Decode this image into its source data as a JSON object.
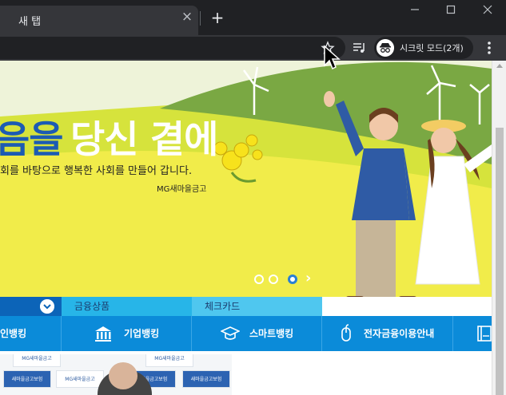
{
  "browser": {
    "tab_title": "새 탭",
    "profile_label": "시크릿 모드(2개)"
  },
  "banner": {
    "title_part1": "음을",
    "title_part2": "당신 곁에",
    "subtitle": "회를 바탕으로 행복한 사회를 만들어 갑니다.",
    "brand": "MG새마을금고",
    "slide_count": 3,
    "active_slide": 3
  },
  "subnav": {
    "items": [
      "금융상품",
      "체크카드"
    ]
  },
  "mainnav": {
    "items": [
      {
        "label": "인뱅킹",
        "icon": "person-icon"
      },
      {
        "label": "기업뱅킹",
        "icon": "bank-building-icon"
      },
      {
        "label": "스마트뱅킹",
        "icon": "graduation-cap-icon"
      },
      {
        "label": "전자금융이용안내",
        "icon": "mouse-icon"
      },
      {
        "label": "",
        "icon": "book-icon"
      }
    ]
  },
  "photo_strip": {
    "tiles": [
      "새마을금고보험",
      "MG새마을금고",
      "MG새마을금고",
      "새마을금고보험",
      "MG새마을금고",
      "새마을금고보험"
    ]
  }
}
